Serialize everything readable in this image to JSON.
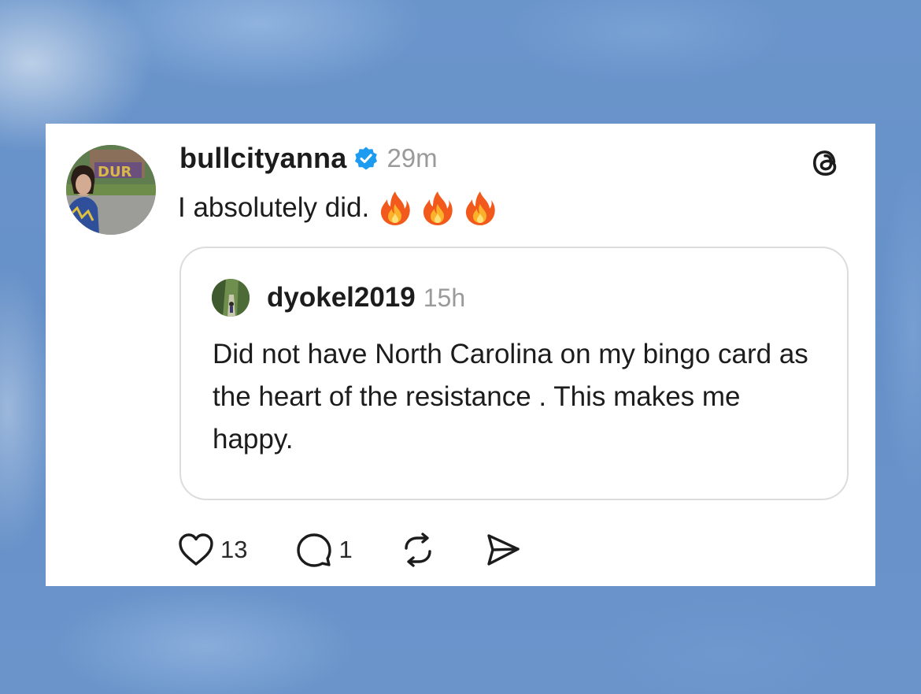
{
  "post": {
    "author": "bullcityanna",
    "verified_icon": "verified-badge-icon",
    "time": "29m",
    "text": "I absolutely did.",
    "emoji": [
      "🔥",
      "🔥",
      "🔥"
    ],
    "brand_icon": "threads-logo-icon"
  },
  "quoted_post": {
    "author": "dyokel2019",
    "time": "15h",
    "text": "Did not have North Carolina on my bingo card as the heart of the resistance . This makes me happy."
  },
  "actions": {
    "like_icon": "heart-icon",
    "like_count": "13",
    "reply_icon": "comment-icon",
    "reply_count": "1",
    "repost_icon": "repost-icon",
    "share_icon": "share-icon"
  },
  "colors": {
    "background": "#6590c8",
    "verified": "#1d9bf0",
    "timestamp": "#9a9a9a",
    "text": "#1c1c1c"
  }
}
